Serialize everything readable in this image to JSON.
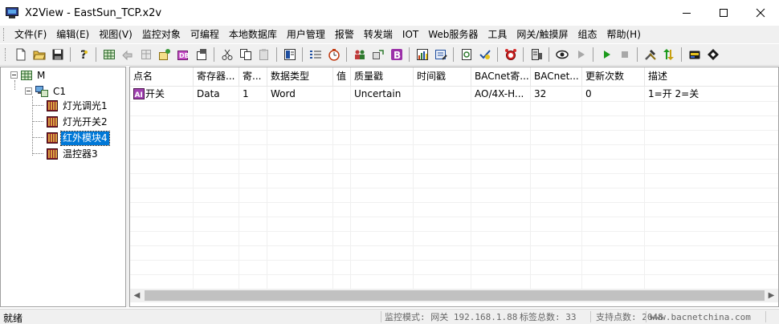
{
  "window": {
    "title": "X2View - EastSun_TCP.x2v"
  },
  "menu": [
    "文件(F)",
    "编辑(E)",
    "视图(V)",
    "监控对象",
    "可编程",
    "本地数据库",
    "用户管理",
    "报警",
    "转发端",
    "IOT",
    "Web服务器",
    "工具",
    "网关/触摸屏",
    "组态",
    "帮助(H)"
  ],
  "toolbar": {
    "groups": [
      [
        "new-file-icon",
        "open-folder-icon",
        "save-icon"
      ],
      [
        "help-icon"
      ],
      [
        "grid-icon",
        "forward-disabled-icon",
        "grid-disabled-icon",
        "add-object-icon",
        "database-icon",
        "properties-icon"
      ],
      [
        "cut-icon",
        "copy-icon",
        "paste-disabled-icon"
      ],
      [
        "monitor-icon"
      ],
      [
        "list-icon",
        "timer-icon"
      ],
      [
        "users-icon",
        "transfer-icon",
        "bold-b-icon"
      ],
      [
        "chart-icon",
        "edit-table-icon"
      ],
      [
        "script-icon",
        "verify-icon"
      ],
      [
        "alarm-clock-icon"
      ],
      [
        "server-icon"
      ],
      [
        "view-eye-icon",
        "play-disabled-icon"
      ],
      [
        "start-icon",
        "stop-icon"
      ],
      [
        "tools-icon",
        "updown-icon"
      ],
      [
        "card-icon",
        "diamond-icon"
      ]
    ]
  },
  "tree": {
    "root": "M",
    "channel": "C1",
    "devices": [
      "灯光调光1",
      "灯光开关2",
      "红外模块4",
      "温控器3"
    ],
    "selected": "红外模块4"
  },
  "table": {
    "columns": [
      "点名",
      "寄存器...",
      "寄...",
      "数据类型",
      "值",
      "质量戳",
      "时间戳",
      "BACnet寄...",
      "BACnet...",
      "更新次数",
      "描述"
    ],
    "rows": [
      [
        "开关",
        "Data",
        "1",
        "Word",
        "",
        "Uncertain",
        "",
        "AO/4X-H...",
        "32",
        "0",
        "1=开 2=关"
      ]
    ]
  },
  "status": {
    "ready": "就绪",
    "mode": "监控模式: 网关 192.168.1.88",
    "tag_total": "标签总数: 33",
    "support": "支持点数: 2048",
    "website": "www.bacnetchina.com"
  },
  "colors": {
    "selection": "#0078d7",
    "chrome": "#f0f0f0"
  }
}
